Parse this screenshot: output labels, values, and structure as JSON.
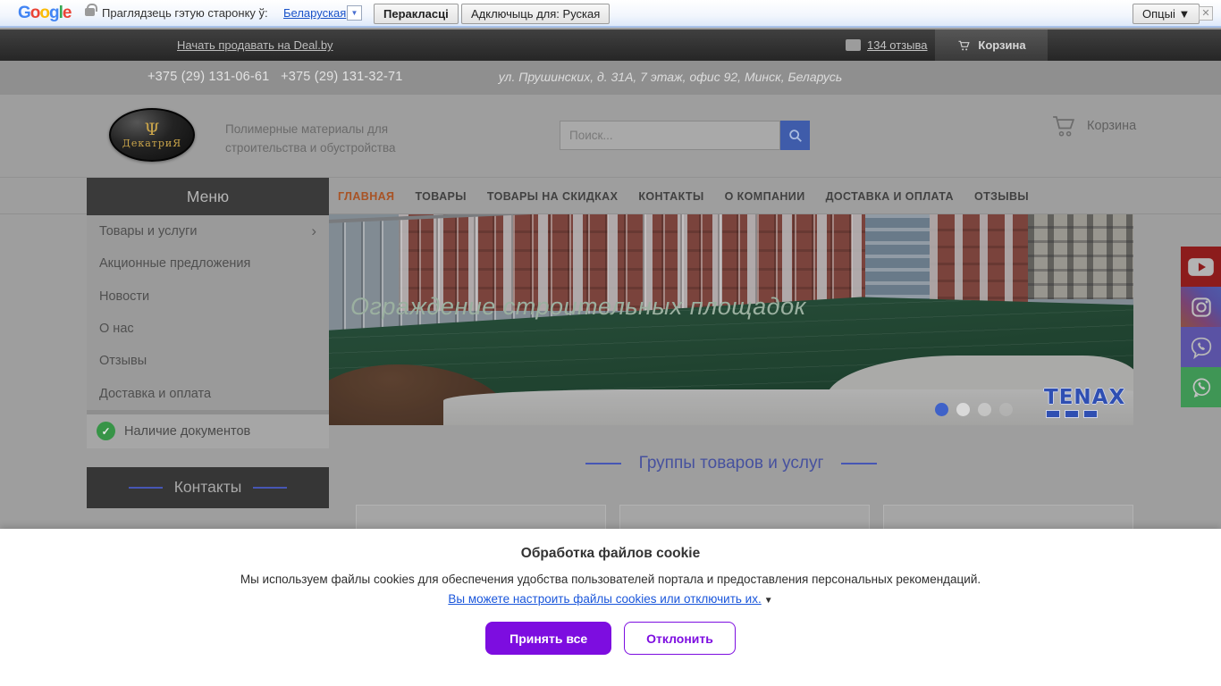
{
  "colors": {
    "accent_purple": "#7d0de0",
    "link_blue": "#1a56db",
    "nav_active_orange": "#a85325",
    "heading_blue": "#46519e",
    "search_button_blue": "#3f5caa",
    "active_dot_blue": "#3f62c8",
    "menu_dark": "#3a3a3a",
    "check_green": "#379447"
  },
  "translate_bar": {
    "logo_letters": [
      "G",
      "o",
      "o",
      "g",
      "l",
      "e"
    ],
    "prompt": "Праглядзець гэтую старонку ў:",
    "language": "Беларуская",
    "dropdown_arrow": "▼",
    "translate_button": "Перакласці",
    "disable_button": "Адключыць для: Руская",
    "options_button": "Опцыі ▼",
    "close": "✕"
  },
  "topbar": {
    "sell_link": "Начать продавать на Deal.by",
    "reviews_link": "134 отзыва",
    "cart_label": "Корзина"
  },
  "infobar": {
    "phone1": "+375 (29) 131-06-61",
    "phone2": "+375 (29) 131-32-71",
    "address": "ул. Прушинских, д. 31А, 7 этаж, офис 92, Минск, Беларусь"
  },
  "header": {
    "logo_emblem": "Ψ",
    "logo_text": "ДекатриЯ",
    "tagline_line1": "Полимерные материалы для",
    "tagline_line2": "строительства и обустройства",
    "search_placeholder": "Поиск...",
    "cart_label": "Корзина"
  },
  "nav": {
    "items": [
      {
        "label": "ГЛАВНАЯ"
      },
      {
        "label": "ТОВАРЫ"
      },
      {
        "label": "ТОВАРЫ НА СКИДКАХ"
      },
      {
        "label": "КОНТАКТЫ"
      },
      {
        "label": "О КОМПАНИИ"
      },
      {
        "label": "ДОСТАВКА И ОПЛАТА"
      },
      {
        "label": "ОТЗЫВЫ"
      }
    ]
  },
  "sidebar": {
    "menu_title": "Меню",
    "items": [
      {
        "label": "Товары и услуги",
        "chevron": "›"
      },
      {
        "label": "Акционные предложения"
      },
      {
        "label": "Новости"
      },
      {
        "label": "О нас"
      },
      {
        "label": "Отзывы"
      },
      {
        "label": "Доставка и оплата"
      }
    ],
    "check_glyph": "✓",
    "documents_label": "Наличие документов",
    "contacts_title": "Контакты"
  },
  "hero": {
    "caption": "Ограждение строительных площадок",
    "brand": "TENAX"
  },
  "main": {
    "groups_title": "Группы товаров и услуг"
  },
  "cookie": {
    "title": "Обработка файлов cookie",
    "text": "Мы используем файлы cookies для обеспечения удобства пользователей портала и предоставления персональных рекомендаций.",
    "settings_link": "Вы можете настроить файлы cookies или отключить их.",
    "arrow": "▼",
    "accept_button": "Принять все",
    "decline_button": "Отклонить"
  }
}
